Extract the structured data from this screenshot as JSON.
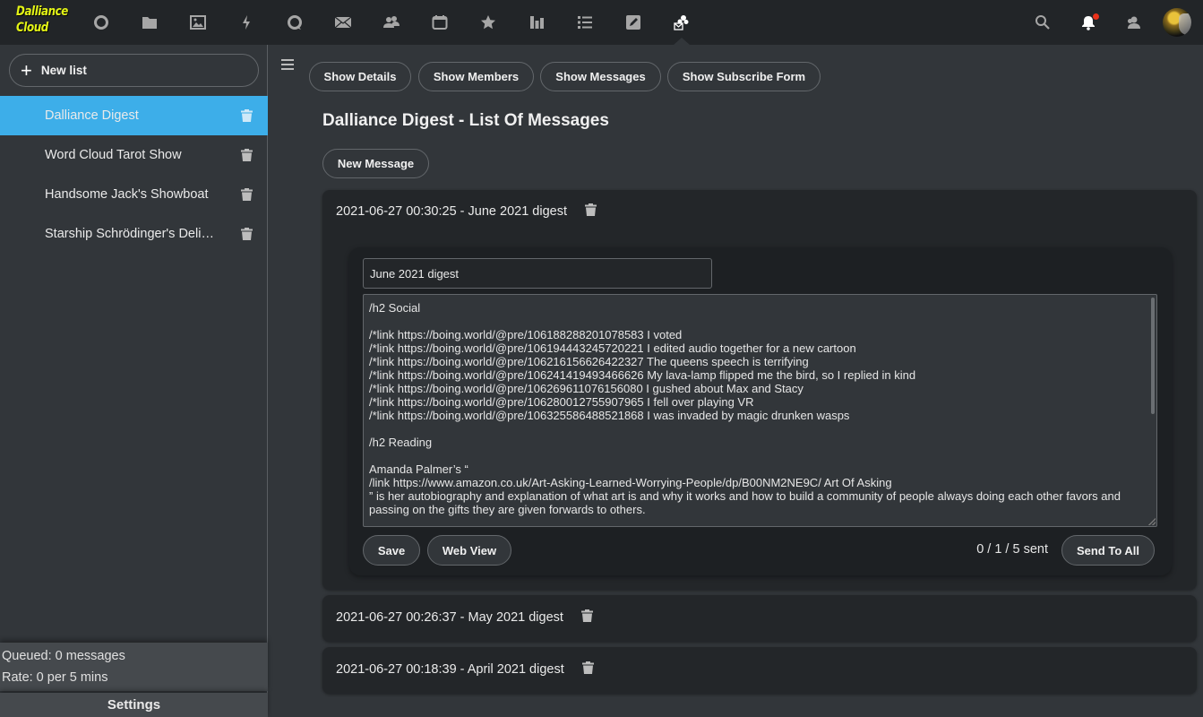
{
  "app": {
    "logo_line1": "Dalliance",
    "logo_line2": "Cloud"
  },
  "topnav": {
    "items": [
      {
        "name": "circle-icon"
      },
      {
        "name": "folder-icon"
      },
      {
        "name": "image-icon"
      },
      {
        "name": "bolt-icon"
      },
      {
        "name": "chat-bubble-icon"
      },
      {
        "name": "mail-icon"
      },
      {
        "name": "contacts-icon"
      },
      {
        "name": "calendar-icon"
      },
      {
        "name": "star-icon"
      },
      {
        "name": "bar-chart-icon"
      },
      {
        "name": "list-icon"
      },
      {
        "name": "notes-icon"
      },
      {
        "name": "newsletter-icon",
        "active": true
      }
    ],
    "right": {
      "search": "search-icon",
      "notifications": "bell-icon",
      "notifications_unread": true,
      "contacts": "contacts-icon",
      "avatar": "user-avatar"
    }
  },
  "sidebar": {
    "new_list_label": "New list",
    "lists": [
      {
        "name": "Dalliance Digest",
        "active": true
      },
      {
        "name": "Word Cloud Tarot Show",
        "active": false
      },
      {
        "name": "Handsome Jack's Showboat",
        "active": false
      },
      {
        "name": "Starship Schrödinger's Delivery",
        "active": false
      }
    ],
    "queued": "Queued: 0 messages",
    "rate": "Rate: 0 per 5 mins",
    "settings_label": "Settings"
  },
  "main": {
    "tabs": [
      {
        "label": "Show Details"
      },
      {
        "label": "Show Members"
      },
      {
        "label": "Show Messages"
      },
      {
        "label": "Show Subscribe Form"
      }
    ],
    "title": "Dalliance Digest - List Of Messages",
    "new_message_label": "New Message",
    "messages": [
      {
        "heading": "2021-06-27 00:30:25 - June 2021 digest",
        "expanded": true,
        "subject": "June 2021 digest",
        "body_lines": [
          "/h2 Social",
          "",
          "/*link https://boing.world/@pre/106188288201078583 I voted",
          "/*link https://boing.world/@pre/106194443245720221 I edited audio together for a new cartoon",
          "/*link https://boing.world/@pre/106216156626422327 The queens speech is terrifying",
          "/*link https://boing.world/@pre/106241419493466626 My lava-lamp flipped me the bird, so I replied in kind",
          "/*link https://boing.world/@pre/106269611076156080 I gushed about Max and Stacy",
          "/*link https://boing.world/@pre/106280012755907965 I fell over playing VR",
          "/*link https://boing.world/@pre/106325586488521868 I was invaded by magic drunken wasps",
          "",
          "/h2 Reading",
          "",
          "Amanda Palmer’s “",
          "/link https://www.amazon.co.uk/Art-Asking-Learned-Worrying-People/dp/B00NM2NE9C/ Art Of Asking",
          "” is her autobiography and explanation of what art is and why it works and how to build a community of people always doing each other favors and",
          "passing on the gifts they are given forwards to others."
        ],
        "save_label": "Save",
        "web_view_label": "Web View",
        "sent_status": "0 / 1 / 5 sent",
        "send_all_label": "Send To All"
      },
      {
        "heading": "2021-06-27 00:26:37 - May 2021 digest",
        "expanded": false
      },
      {
        "heading": "2021-06-27 00:18:39 - April 2021 digest",
        "expanded": false
      }
    ]
  },
  "colors": {
    "accent": "#3daee9",
    "topbar_bg": "#222528",
    "page_bg": "#32363a",
    "card_bg": "#232629",
    "logo": "#e4f516",
    "notification_dot": "#e9311a"
  }
}
